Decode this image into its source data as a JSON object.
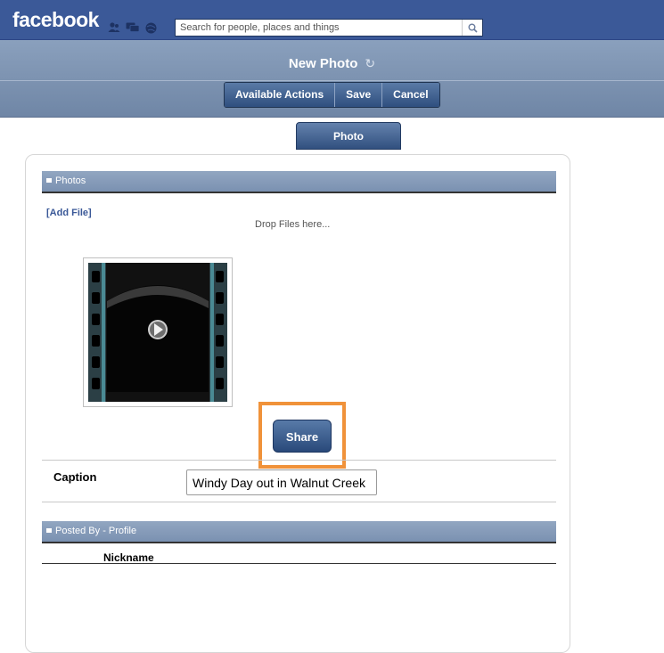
{
  "fb": {
    "logo": "facebook",
    "search_placeholder": "Search for people, places and things",
    "icons": [
      "friends-icon",
      "messages-icon",
      "notifications-icon",
      "search-icon"
    ]
  },
  "header": {
    "title": "New Photo",
    "refresh_icon": "refresh-icon",
    "actions": [
      "Available Actions",
      "Save",
      "Cancel"
    ]
  },
  "tabs": [
    {
      "label": "Photo"
    }
  ],
  "photos_section": {
    "title": "Photos",
    "add_file": "[Add File]",
    "drop_text": "Drop Files here...",
    "thumbnail_icon": "video-film-icon",
    "share_label": "Share"
  },
  "caption": {
    "label": "Caption",
    "value": "Windy Day out in Walnut Creek"
  },
  "posted_by": {
    "title": "Posted By - Profile",
    "column": "Nickname"
  },
  "colors": {
    "fb_blue": "#3b5998",
    "button_blue": "#2f4f7f",
    "highlight": "#f0923a",
    "section_header": "#7a91b1"
  }
}
